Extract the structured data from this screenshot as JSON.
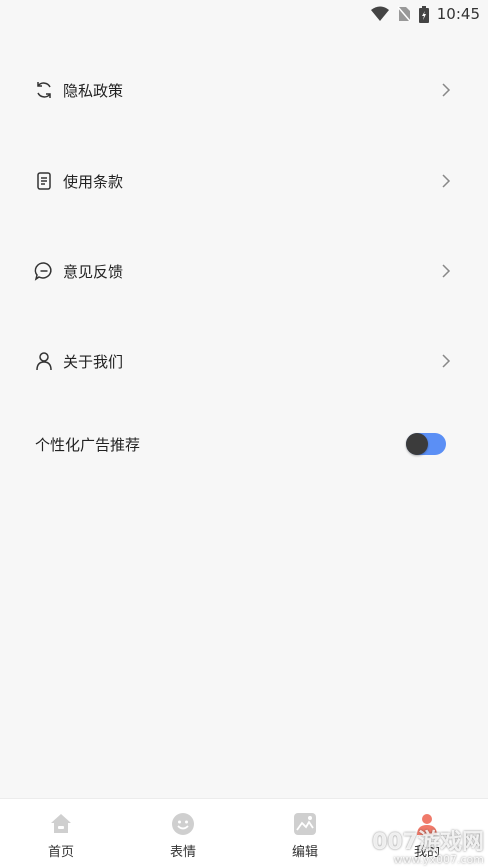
{
  "status": {
    "time": "10:45"
  },
  "menu": [
    {
      "label": "隐私政策",
      "icon": "refresh-icon"
    },
    {
      "label": "使用条款",
      "icon": "document-icon"
    },
    {
      "label": "意见反馈",
      "icon": "chat-icon"
    },
    {
      "label": "关于我们",
      "icon": "person-icon"
    }
  ],
  "toggle": {
    "label": "个性化广告推荐",
    "on": true
  },
  "tabs": [
    {
      "label": "首页",
      "icon": "home-icon"
    },
    {
      "label": "表情",
      "icon": "smiley-icon"
    },
    {
      "label": "编辑",
      "icon": "image-edit-icon"
    },
    {
      "label": "我的",
      "icon": "profile-icon"
    }
  ],
  "colors": {
    "accent": "#5b8ff5",
    "background": "#f7f7f7",
    "active_tab": "#f07a6a"
  },
  "watermark": {
    "brand": "007游戏网",
    "url": "www.yx007.com"
  }
}
